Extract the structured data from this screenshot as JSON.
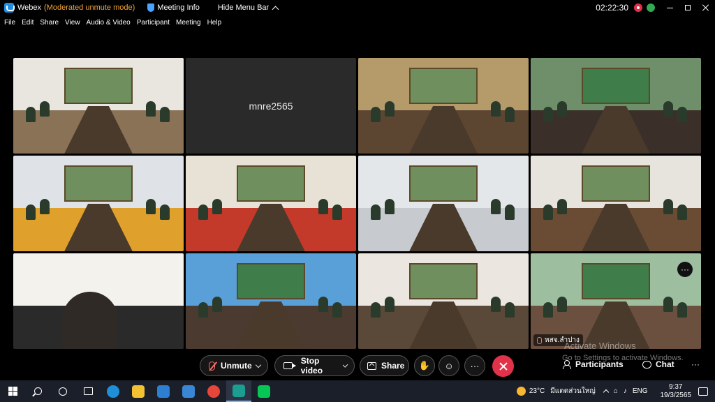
{
  "titlebar": {
    "app_name": "Webex",
    "mode": "(Moderated unmute mode)",
    "meeting_info": "Meeting Info",
    "hide_menu": "Hide Menu Bar",
    "clock": "02:22:30"
  },
  "menu": [
    "File",
    "Edit",
    "Share",
    "View",
    "Audio & Video",
    "Participant",
    "Meeting",
    "Help"
  ],
  "tiles": [
    {
      "type": "video",
      "scene": "meeting-room",
      "wall": "#e9e6e0",
      "floor": "#8a7257"
    },
    {
      "type": "name",
      "name": "mnre2565"
    },
    {
      "type": "video",
      "scene": "meeting-room",
      "wall": "#b59a6a",
      "floor": "#5c4631"
    },
    {
      "type": "video",
      "scene": "banner-room",
      "wall": "#6e8f6a",
      "floor": "#3b2f2a"
    },
    {
      "type": "video",
      "scene": "meeting-room",
      "wall": "#dfe3e8",
      "floor": "#e0a02c"
    },
    {
      "type": "video",
      "scene": "meeting-room",
      "wall": "#e8e2d6",
      "floor": "#c43a2a"
    },
    {
      "type": "video",
      "scene": "meeting-room",
      "wall": "#e4e7ea",
      "floor": "#c7cbd0"
    },
    {
      "type": "video",
      "scene": "meeting-room",
      "wall": "#e7e3dd",
      "floor": "#6a4c34"
    },
    {
      "type": "video",
      "scene": "person-closeup",
      "wall": "#f4f2ec",
      "floor": "#2a2a2a"
    },
    {
      "type": "video",
      "scene": "banner-room",
      "wall": "#5aa0d8",
      "floor": "#4b3a30"
    },
    {
      "type": "video",
      "scene": "meeting-room",
      "wall": "#ebe7e0",
      "floor": "#5a4838"
    },
    {
      "type": "video",
      "scene": "banner-room",
      "wall": "#9dbfa0",
      "floor": "#6b5040",
      "label": "หสจ.ลำปาง",
      "show_more": true
    }
  ],
  "watermark": {
    "title": "Activate Windows",
    "subtitle": "Go to Settings to activate Windows."
  },
  "controls": {
    "unmute": "Unmute",
    "stop_video": "Stop video",
    "share": "Share",
    "more": "···",
    "participants": "Participants",
    "chat": "Chat",
    "overflow": "···"
  },
  "tile_more": "···",
  "taskbar": {
    "weather": "23°C",
    "weather_text": "มีแดดส่วนใหญ่",
    "lang": "ENG",
    "time": "9:37",
    "date": "19/3/2565",
    "apps": [
      {
        "name": "edge",
        "color": "#1f8fd8"
      },
      {
        "name": "file-explorer",
        "color": "#f2c230"
      },
      {
        "name": "store",
        "color": "#2d7fd2"
      },
      {
        "name": "mail",
        "color": "#3a86d6"
      },
      {
        "name": "chrome",
        "color": "#e7473b"
      },
      {
        "name": "webex",
        "color": "#1a9e8f"
      },
      {
        "name": "line",
        "color": "#06c755"
      }
    ]
  }
}
